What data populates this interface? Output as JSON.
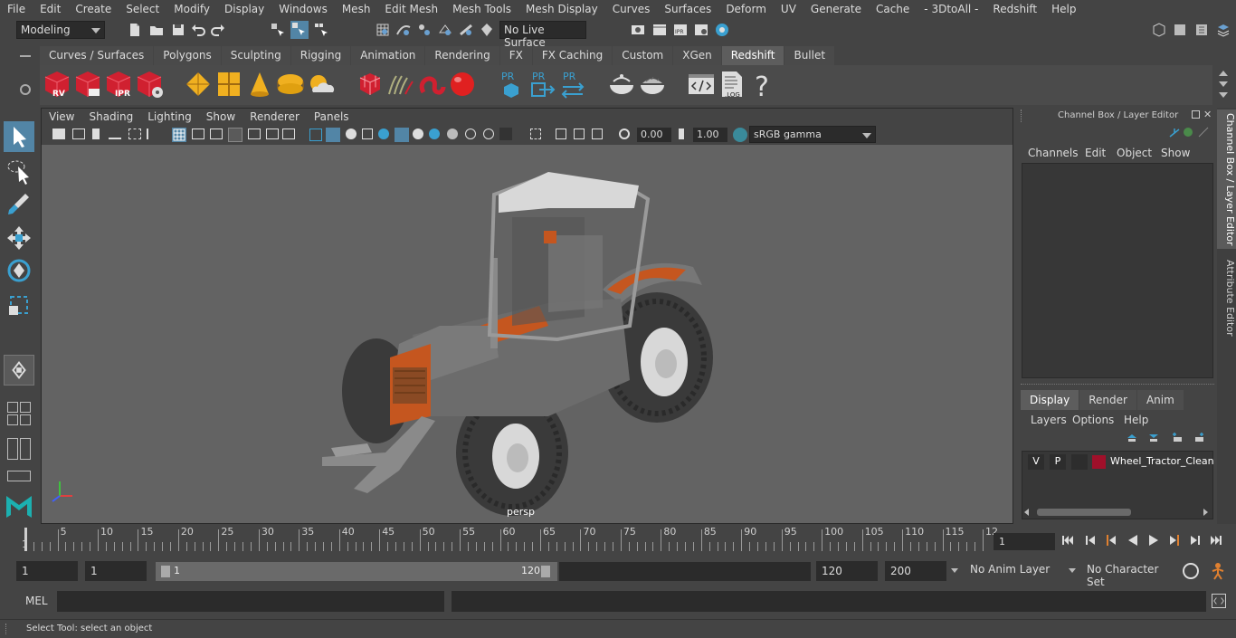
{
  "menubar": {
    "items": [
      "File",
      "Edit",
      "Create",
      "Select",
      "Modify",
      "Display",
      "Windows",
      "Mesh",
      "Edit Mesh",
      "Mesh Tools",
      "Mesh Display",
      "Curves",
      "Surfaces",
      "Deform",
      "UV",
      "Generate",
      "Cache",
      "- 3DtoAll -",
      "Redshift",
      "Help"
    ]
  },
  "statusline": {
    "mode": "Modeling",
    "live_surface": "No Live Surface"
  },
  "shelf": {
    "tabs": [
      "Curves / Surfaces",
      "Polygons",
      "Sculpting",
      "Rigging",
      "Animation",
      "Rendering",
      "FX",
      "FX Caching",
      "Custom",
      "XGen",
      "Redshift",
      "Bullet"
    ],
    "active_tab": "Redshift",
    "icon_labels": {
      "rv": "RV",
      "ipr": "IPR",
      "pr": "PR",
      "log": ".LOG",
      "help": "?"
    }
  },
  "viewport": {
    "menus": [
      "View",
      "Shading",
      "Lighting",
      "Show",
      "Renderer",
      "Panels"
    ],
    "exposure": "0.00",
    "gamma": "1.00",
    "color_space": "sRGB gamma",
    "camera": "persp"
  },
  "channel_box": {
    "title": "Channel Box / Layer Editor",
    "menus": [
      "Channels",
      "Edit",
      "Object",
      "Show"
    ]
  },
  "layer_editor": {
    "tabs": [
      "Display",
      "Render",
      "Anim"
    ],
    "active_tab": "Display",
    "menus": [
      "Layers",
      "Options",
      "Help"
    ],
    "layer": {
      "visible": "V",
      "playback": "P",
      "color": "#a0102a",
      "name": "Wheel_Tractor_Clean"
    }
  },
  "side_tabs": {
    "channel_box": "Channel Box / Layer Editor",
    "attribute_editor": "Attribute Editor"
  },
  "timeline": {
    "start_label": "1",
    "labels": [
      "5",
      "10",
      "15",
      "20",
      "25",
      "30",
      "35",
      "40",
      "45",
      "50",
      "55",
      "60",
      "65",
      "70",
      "75",
      "80",
      "85",
      "90",
      "95",
      "100",
      "105",
      "110",
      "115",
      "12"
    ],
    "current_frame": "1"
  },
  "range": {
    "start": "1",
    "playback_start": "1",
    "slider_start": "1",
    "slider_end": "120",
    "playback_end": "120",
    "end": "200",
    "anim_layer": "No Anim Layer",
    "character_set": "No Character Set"
  },
  "command_line": {
    "language": "MEL"
  },
  "help_line": {
    "text": "Select Tool: select an object"
  },
  "colors": {
    "accent_selected": "#5285a6",
    "tractor_orange": "#c5561f",
    "redshift_red": "#d02030"
  }
}
